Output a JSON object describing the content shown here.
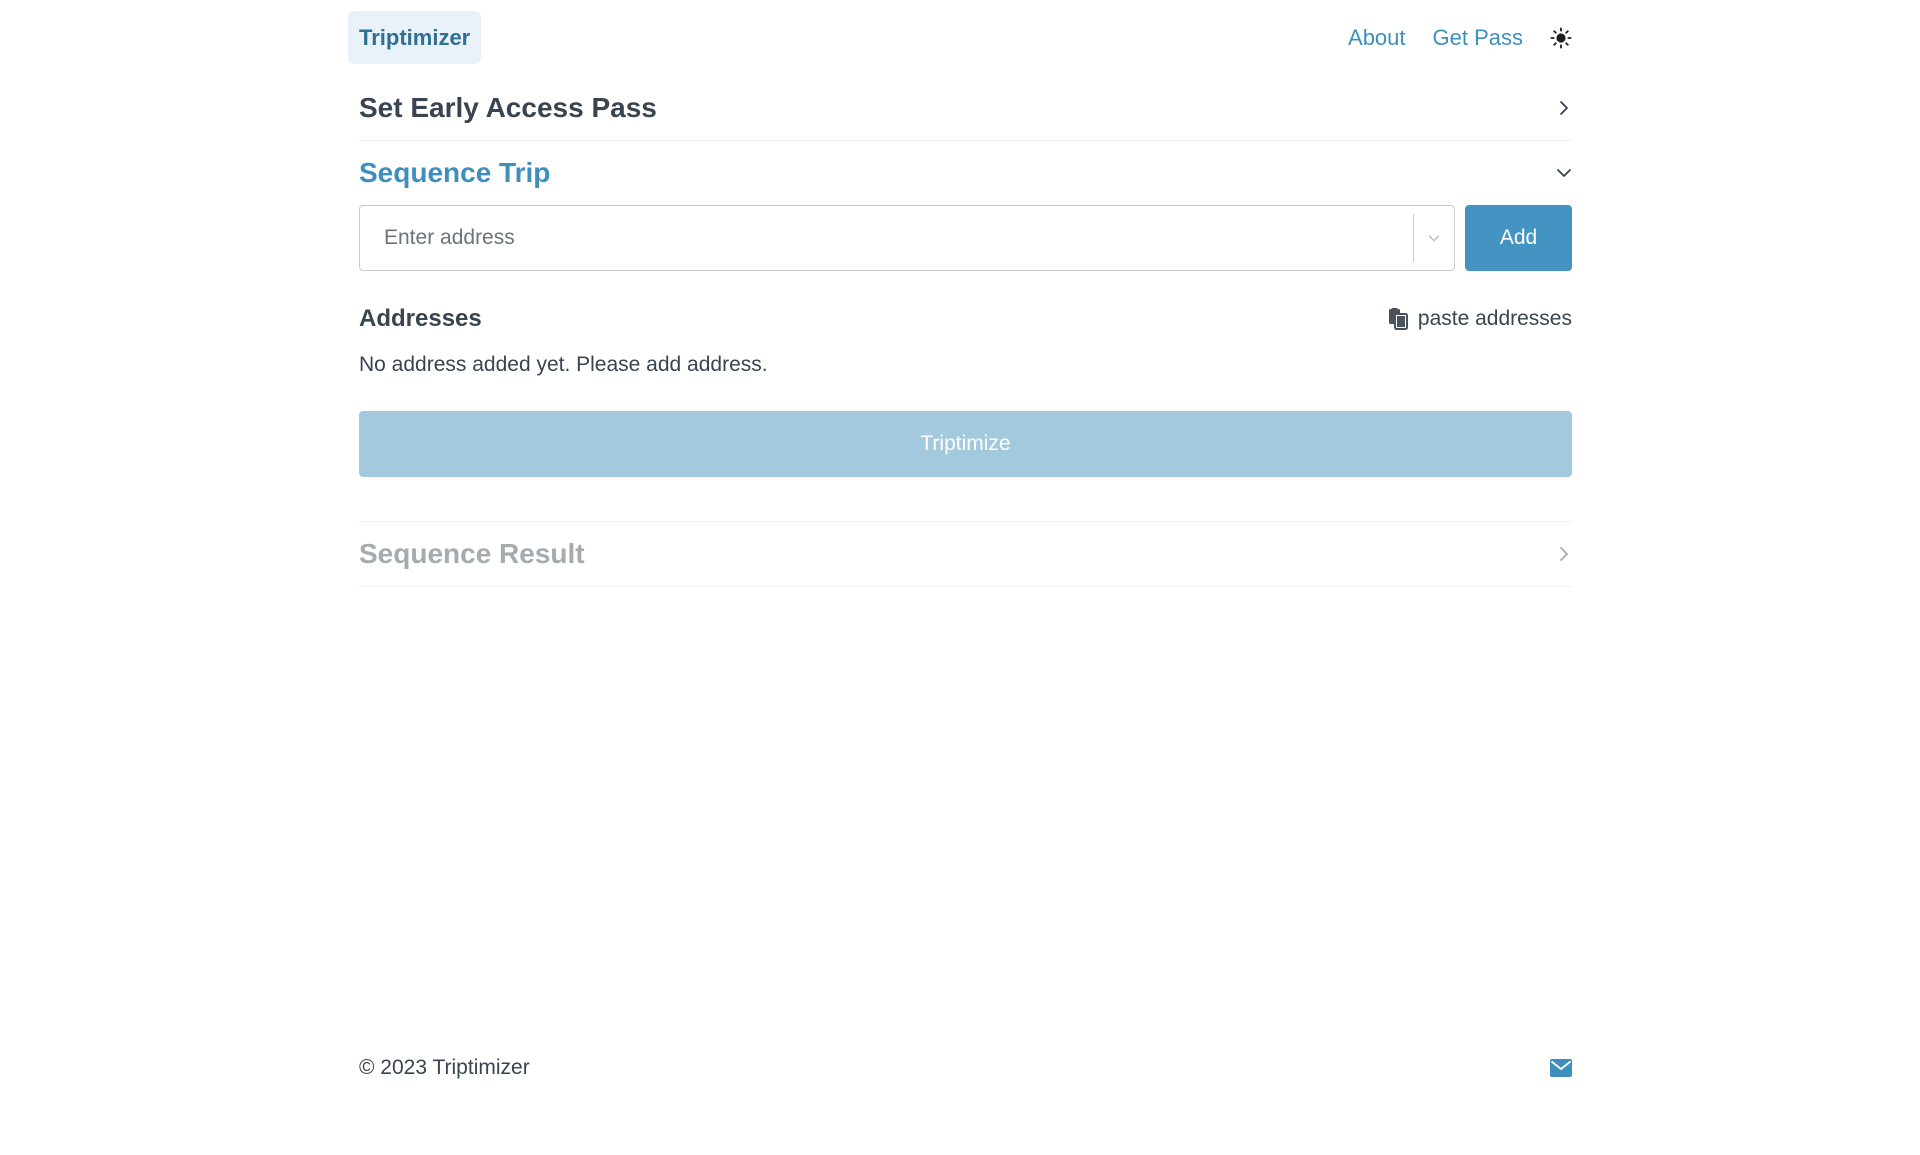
{
  "nav": {
    "brand": "Triptimizer",
    "links": [
      {
        "label": "About"
      },
      {
        "label": "Get Pass"
      }
    ],
    "theme_icon": "sun-icon"
  },
  "sections": {
    "early_access": {
      "title": "Set Early Access Pass",
      "state": "collapsed"
    },
    "sequence_trip": {
      "title": "Sequence Trip",
      "state": "expanded"
    },
    "sequence_result": {
      "title": "Sequence Result",
      "state": "disabled"
    }
  },
  "address_input": {
    "placeholder": "Enter address",
    "value": ""
  },
  "add_button": {
    "label": "Add"
  },
  "addresses": {
    "title": "Addresses",
    "paste_label": "paste addresses",
    "empty_message": "No address added yet. Please add address."
  },
  "triptimize_button": {
    "label": "Triptimize"
  },
  "footer": {
    "copyright": "© 2023 Triptimizer",
    "mail_icon": "envelope-icon"
  },
  "colors": {
    "accent": "#4493c2",
    "accent_disabled": "#a2c9de",
    "text": "#3a4450",
    "muted": "#a6abb0"
  }
}
